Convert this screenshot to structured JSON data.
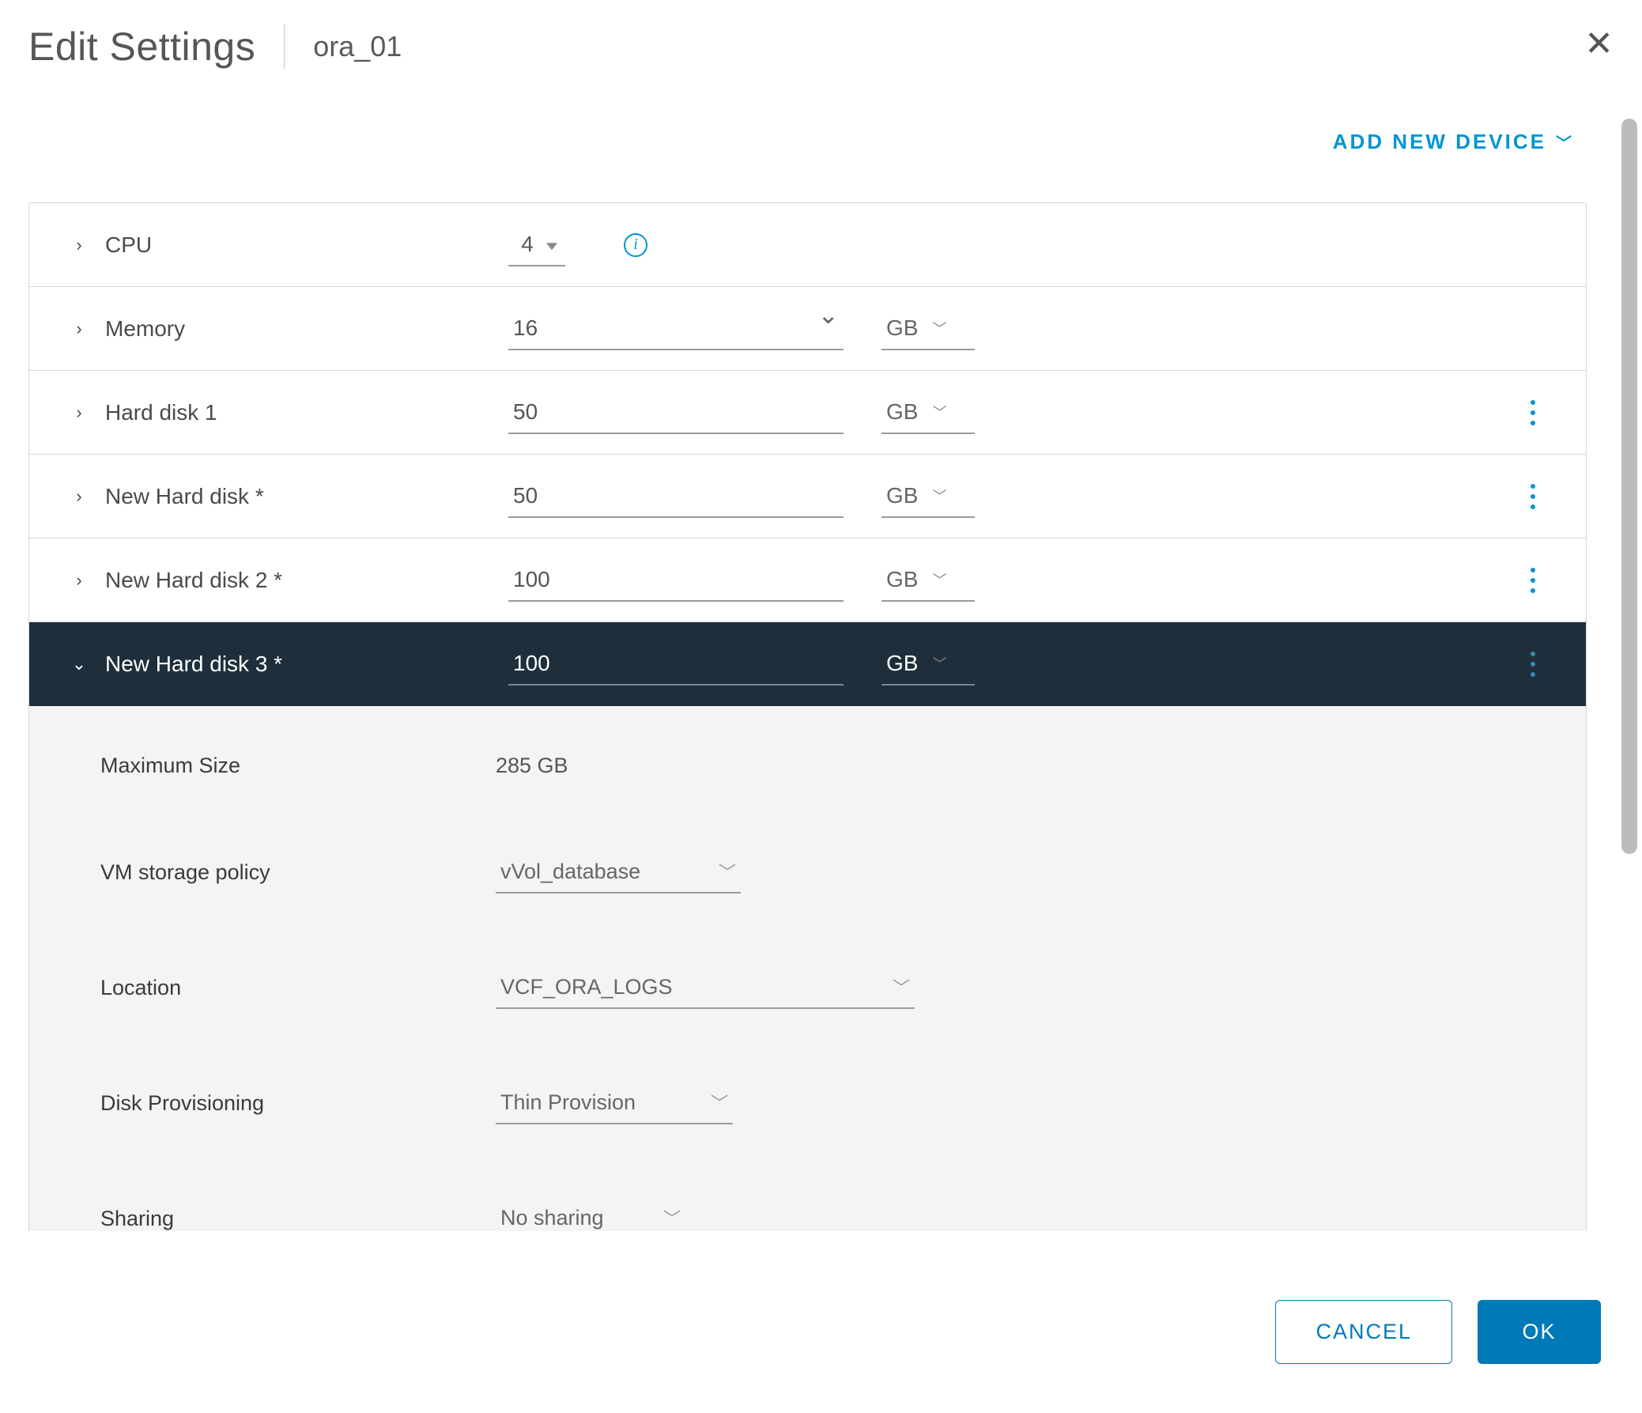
{
  "header": {
    "title": "Edit Settings",
    "subtitle": "ora_01",
    "add_device": "ADD NEW DEVICE"
  },
  "rows": {
    "cpu": {
      "label": "CPU",
      "value": "4"
    },
    "memory": {
      "label": "Memory",
      "value": "16",
      "unit": "GB"
    },
    "hdd1": {
      "label": "Hard disk 1",
      "value": "50",
      "unit": "GB"
    },
    "newhdd": {
      "label": "New Hard disk *",
      "value": "50",
      "unit": "GB"
    },
    "newhdd2": {
      "label": "New Hard disk 2 *",
      "value": "100",
      "unit": "GB"
    },
    "newhdd3": {
      "label": "New Hard disk 3 *",
      "value": "100",
      "unit": "GB"
    }
  },
  "expanded": {
    "max_size": {
      "label": "Maximum Size",
      "value": "285 GB"
    },
    "storage_policy": {
      "label": "VM storage policy",
      "value": "vVol_database"
    },
    "location": {
      "label": "Location",
      "value": "VCF_ORA_LOGS"
    },
    "provisioning": {
      "label": "Disk Provisioning",
      "value": "Thin Provision"
    },
    "sharing": {
      "label": "Sharing",
      "value": "No sharing"
    }
  },
  "footer": {
    "cancel": "CANCEL",
    "ok": "OK"
  }
}
